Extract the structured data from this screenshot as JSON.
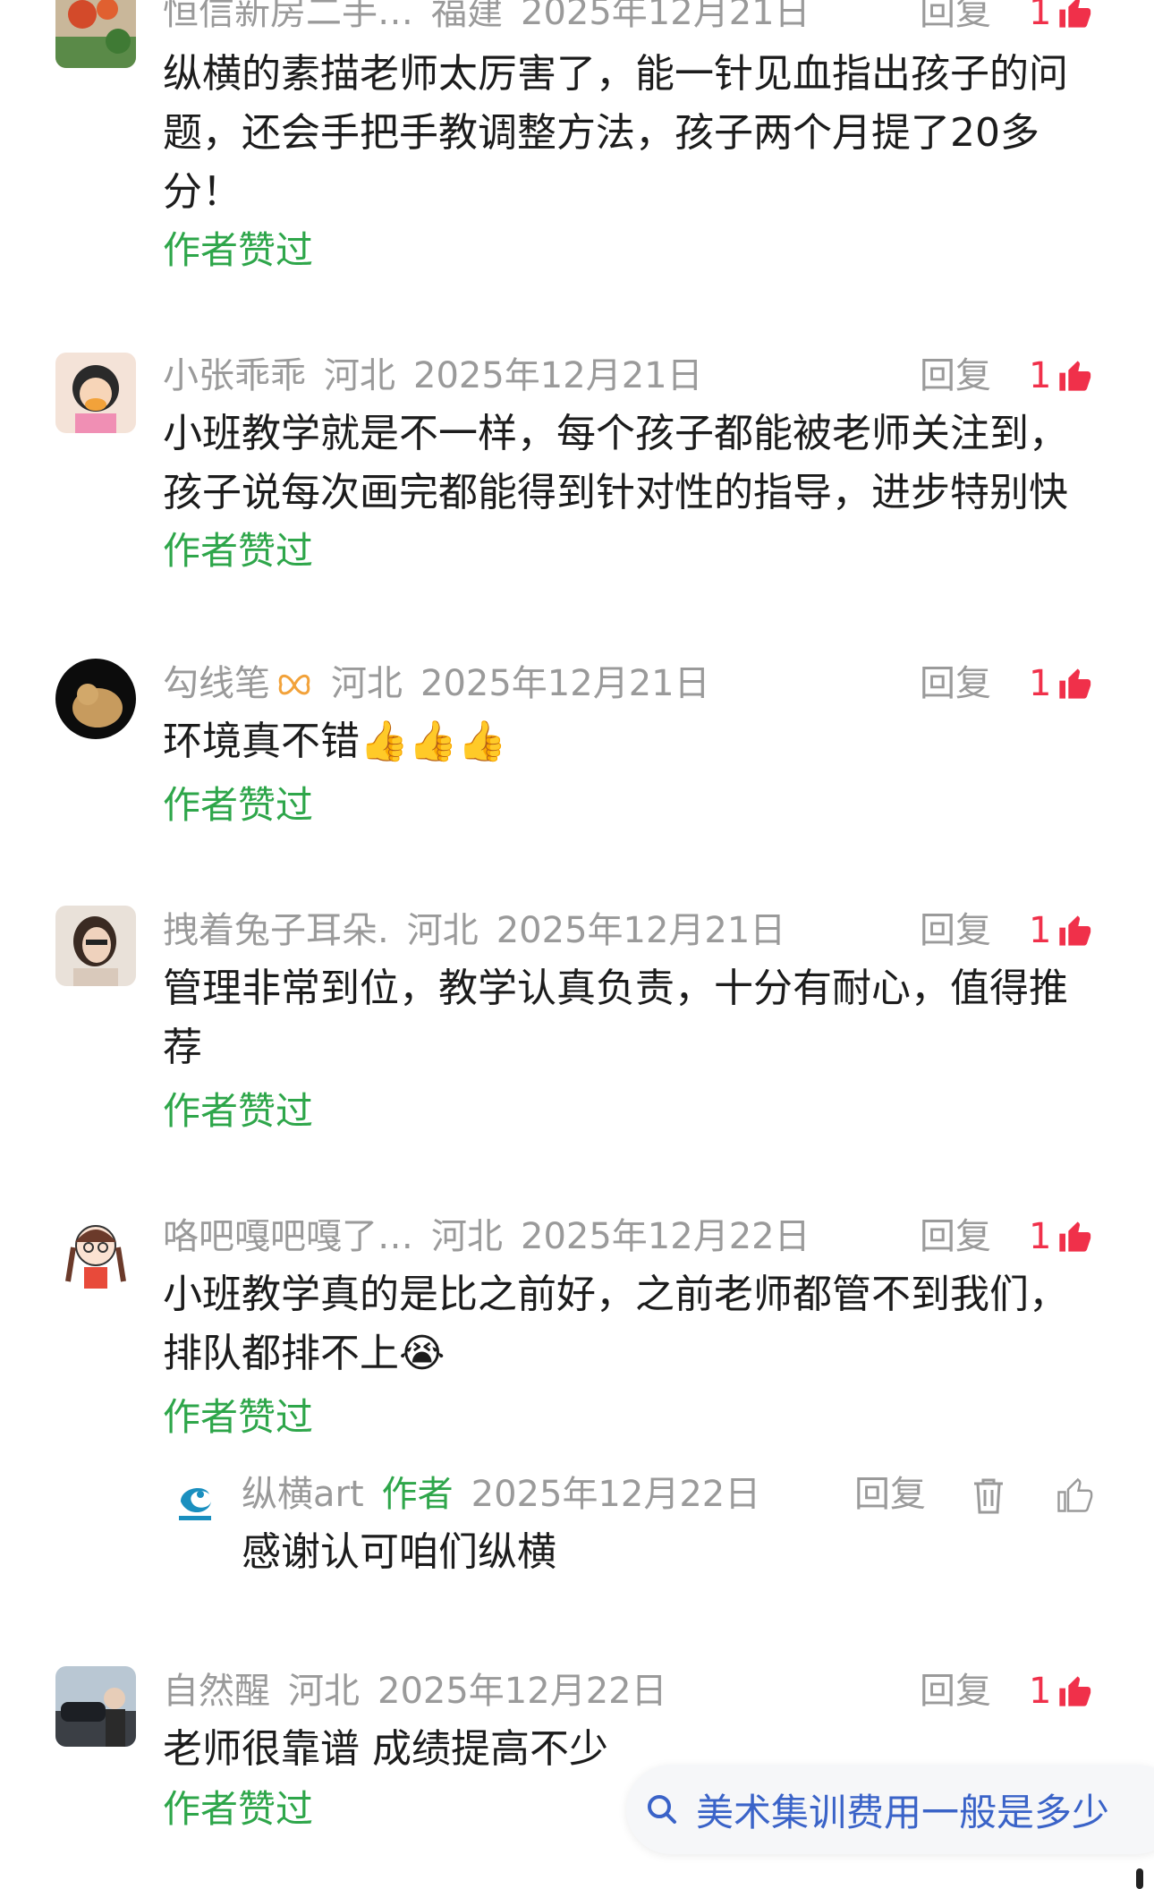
{
  "comments": [
    {
      "username": "恒信新房二手…",
      "location": "福建",
      "date": "2025年12月21日",
      "reply_label": "回复",
      "likes": "1",
      "text": "纵横的素描老师太厉害了，能一针见血指出孩子的问题，还会手把手教调整方法，孩子两个月提了20多分！",
      "liked_label": "作者赞过"
    },
    {
      "username": "小张乖乖",
      "location": "河北",
      "date": "2025年12月21日",
      "reply_label": "回复",
      "likes": "1",
      "text": "小班教学就是不一样，每个孩子都能被老师关注到，孩子说每次画完都能得到针对性的指导，进步特别快",
      "liked_label": "作者赞过"
    },
    {
      "username": "勾线笔",
      "location": "河北",
      "date": "2025年12月21日",
      "reply_label": "回复",
      "likes": "1",
      "text": "环境真不错👍👍👍",
      "liked_label": "作者赞过"
    },
    {
      "username": "拽着兔子耳朵.",
      "location": "河北",
      "date": "2025年12月21日",
      "reply_label": "回复",
      "likes": "1",
      "text": "管理非常到位，教学认真负责，十分有耐心，值得推荐",
      "liked_label": "作者赞过"
    },
    {
      "username": "咯吧嘎吧嘎了…",
      "location": "河北",
      "date": "2025年12月22日",
      "reply_label": "回复",
      "likes": "1",
      "text": "小班教学真的是比之前好，之前老师都管不到我们，排队都排不上😭",
      "liked_label": "作者赞过"
    },
    {
      "username": "自然醒",
      "location": "河北",
      "date": "2025年12月22日",
      "reply_label": "回复",
      "likes": "1",
      "text": "老师很靠谱 成绩提高不少",
      "liked_label": "作者赞过"
    }
  ],
  "author_reply": {
    "username": "纵横art",
    "author_tag": "作者",
    "date": "2025年12月22日",
    "reply_label": "回复",
    "text": "感谢认可咱们纵横"
  },
  "search_suggestion": {
    "text": "美术集训费用一般是多少",
    "icon": "search-icon"
  },
  "colors": {
    "accent_green": "#2ea64a",
    "like_red": "#f0304a",
    "meta_gray": "#9a9a9a",
    "search_blue": "#3a63c8"
  }
}
